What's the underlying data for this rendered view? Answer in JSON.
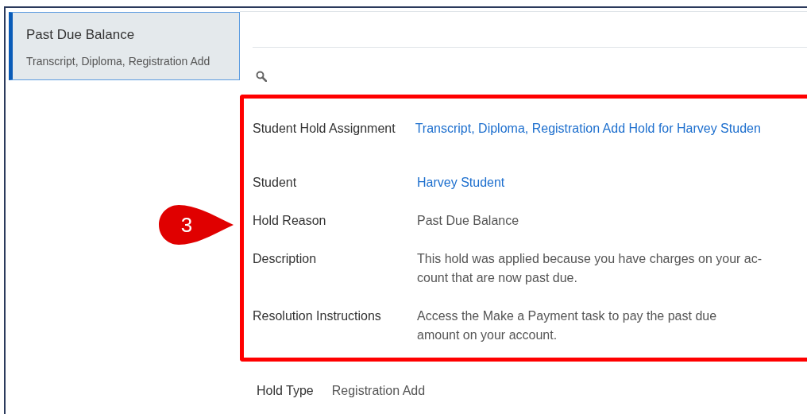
{
  "sidebar": {
    "items": [
      {
        "title": "Past Due Balance",
        "subtitle": "Transcript, Diploma, Registration Add",
        "selected": true
      }
    ]
  },
  "callout": {
    "label": "3"
  },
  "details": [
    {
      "label": "Student Hold Assignment",
      "value": "Transcript, Diploma, Registration Add Hold for Harvey Studen",
      "kind": "link"
    },
    {
      "label": "Student",
      "value": "Harvey Student",
      "kind": "link"
    },
    {
      "label": "Hold Reason",
      "value": "Past Due Balance",
      "kind": "text"
    },
    {
      "label": "Description",
      "value": "This hold was applied because you have charges on your ac-\ncount that are now past due.",
      "kind": "text"
    },
    {
      "label": "Resolution Instructions",
      "value": "Access the Make a Payment task to pay the past due\namount on your account.",
      "kind": "text"
    }
  ],
  "hold_type": {
    "label": "Hold Type",
    "value": "Registration Add"
  }
}
